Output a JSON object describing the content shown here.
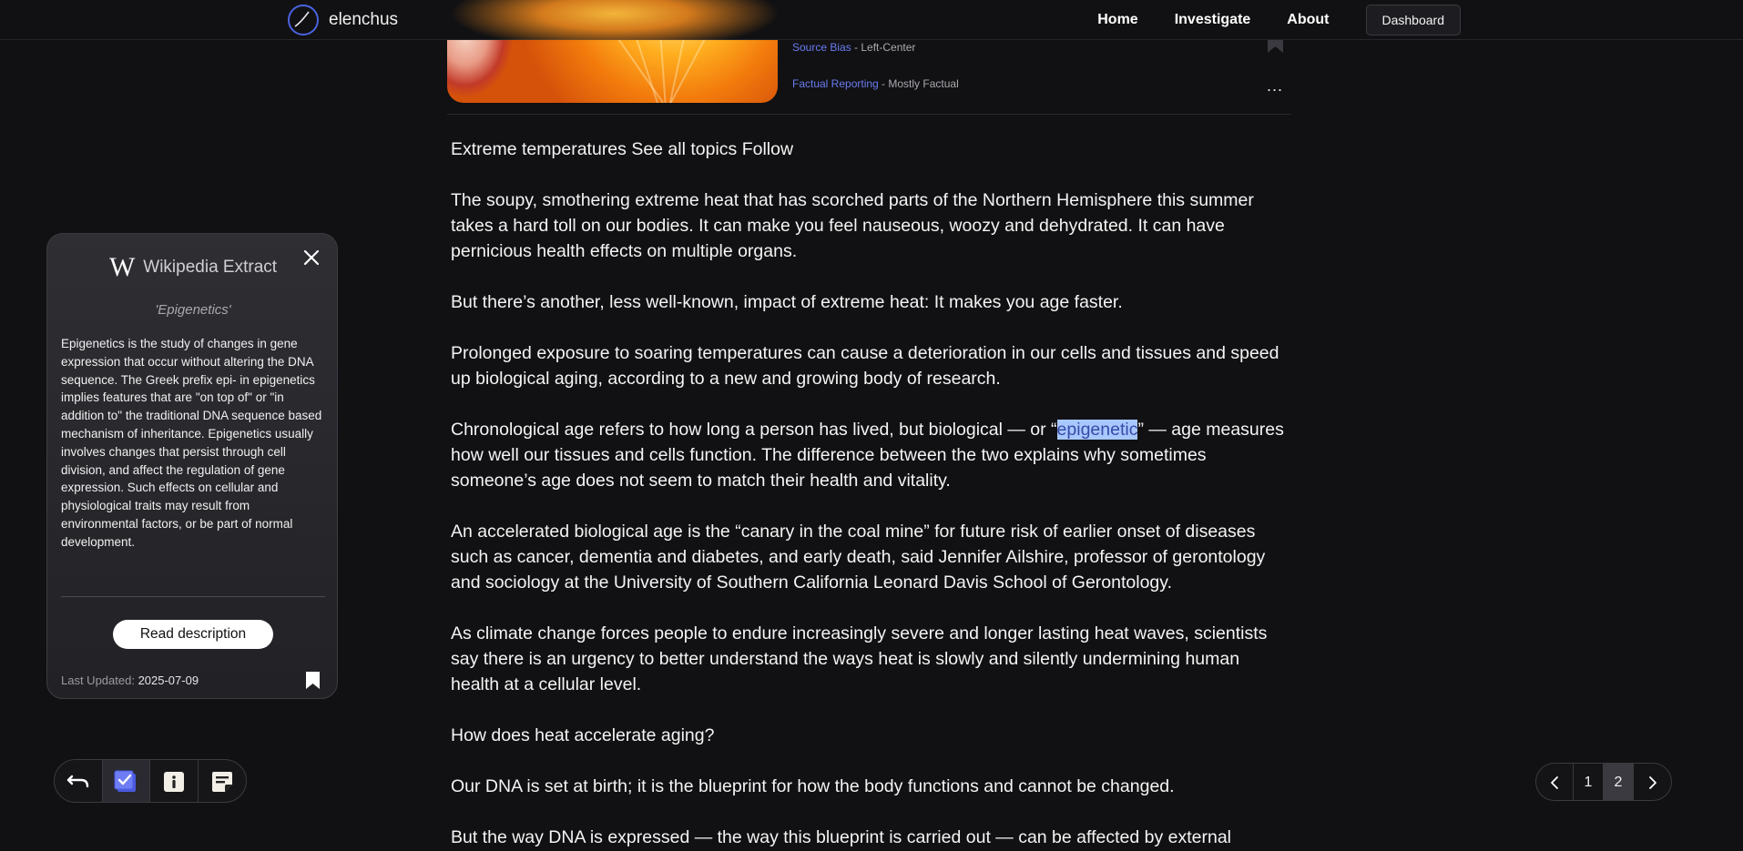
{
  "nav": {
    "brand": "elenchus",
    "links": [
      "Home",
      "Investigate",
      "About"
    ],
    "dashboard": "Dashboard"
  },
  "source": {
    "bias_label": "Source Bias",
    "bias_value": " - Left-Center",
    "factual_label": "Factual Reporting",
    "factual_value": " - Mostly Factual",
    "more": "..."
  },
  "article": {
    "p1": "Extreme temperatures See all topics Follow",
    "p2": "The soupy, smothering extreme heat that has scorched parts of the Northern Hemisphere this summer takes a hard toll on our bodies. It can make you feel nauseous, woozy and dehydrated. It can have pernicious health effects on multiple organs.",
    "p3": "But there’s another, less well-known, impact of extreme heat: It makes you age faster.",
    "p4": "Prolonged exposure to soaring temperatures can cause a deterioration in our cells and tissues and speed up biological aging, according to a new and growing body of research.",
    "p5_before": "Chronological age refers to how long a person has lived, but biological — or “",
    "p5_highlight": "epigenetic",
    "p5_after": "” — age measures how well our tissues and cells function. The difference between the two explains why sometimes someone’s age does not seem to match their health and vitality.",
    "p6": "An accelerated biological age is the “canary in the coal mine” for future risk of earlier onset of diseases such as cancer, dementia and diabetes, and early death, said Jennifer Ailshire, professor of gerontology and sociology at the University of Southern California Leonard Davis School of Gerontology.",
    "p7": "As climate change forces people to endure increasingly severe and longer lasting heat waves, scientists say there is an urgency to better understand the ways heat is slowly and silently undermining human health at a cellular level.",
    "p8": "How does heat accelerate aging?",
    "p9": "Our DNA is set at birth; it is the blueprint for how the body functions and cannot be changed.",
    "p10": "But the way DNA is expressed — the way this blueprint is carried out — can be affected by external"
  },
  "wiki": {
    "logo": "W",
    "title": "Wikipedia Extract",
    "term": "'Epigenetics'",
    "extract": "Epigenetics is the study of changes in gene expression that occur without altering the DNA sequence. The Greek prefix epi- in epigenetics implies features that are \"on top of\" or \"in addition to\" the traditional DNA sequence based mechanism of inheritance. Epigenetics usually involves changes that persist through cell division, and affect the regulation of gene expression. Such effects on cellular and physiological traits may result from environmental factors, or be part of normal development.",
    "button": "Read description",
    "updated_label": "Last Updated: ",
    "updated_value": "2025-07-09"
  },
  "toolbar": {
    "icons": [
      "undo-icon",
      "checklist-icon",
      "info-icon",
      "notes-icon"
    ]
  },
  "pager": {
    "pages": [
      "1",
      "2"
    ],
    "current": "2"
  },
  "colors": {
    "background": "#111113",
    "accent": "#6a7cf0",
    "highlight": "#a8c8ff"
  }
}
